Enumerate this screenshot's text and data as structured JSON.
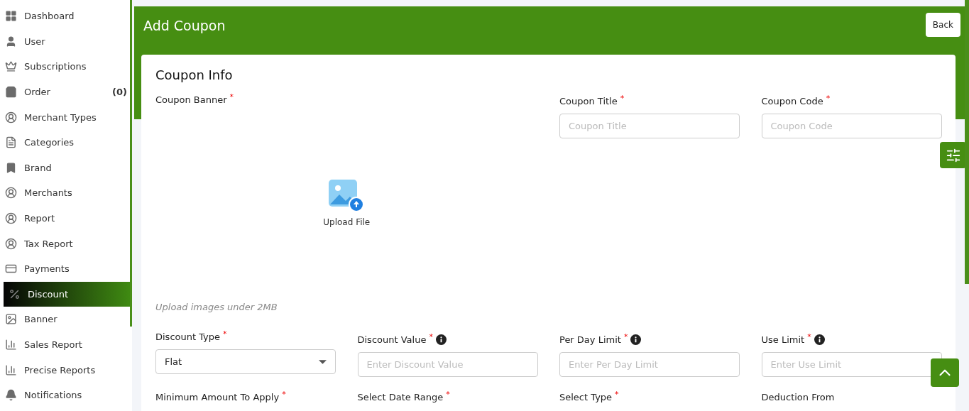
{
  "sidebar": {
    "items": [
      {
        "label": "Dashboard",
        "selected": false
      },
      {
        "label": "User",
        "selected": false
      },
      {
        "label": "Subscriptions",
        "selected": false
      },
      {
        "label": "Order",
        "count": "(0)",
        "selected": false
      },
      {
        "label": "Merchant Types",
        "selected": false
      },
      {
        "label": "Categories",
        "selected": false
      },
      {
        "label": "Brand",
        "selected": false
      },
      {
        "label": "Merchants",
        "selected": false
      },
      {
        "label": "Report",
        "selected": false
      },
      {
        "label": "Tax Report",
        "selected": false
      },
      {
        "label": "Payments",
        "selected": false
      },
      {
        "label": "Discount",
        "selected": true
      },
      {
        "label": "Banner",
        "selected": false
      },
      {
        "label": "Sales Report",
        "selected": false
      },
      {
        "label": "Precise Reports",
        "selected": false
      },
      {
        "label": "Notifications",
        "selected": false
      }
    ]
  },
  "header": {
    "title": "Add Coupon",
    "back_button": "Back"
  },
  "card": {
    "title": "Coupon Info",
    "banner": {
      "label": "Coupon Banner",
      "required_mark": "*",
      "upload_label": "Upload File",
      "hint": "Upload images under 2MB"
    },
    "top_fields": [
      {
        "label": "Coupon Title",
        "required_mark": "*",
        "placeholder": "Coupon Title"
      },
      {
        "label": "Coupon Code",
        "required_mark": "*",
        "placeholder": "Coupon Code"
      }
    ],
    "fields": [
      {
        "kind": "select",
        "label": "Discount Type",
        "required_mark": "*",
        "value": "Flat",
        "info": false
      },
      {
        "kind": "input",
        "label": "Discount Value",
        "required_mark": "*",
        "placeholder": "Enter Discount Value",
        "info": true
      },
      {
        "kind": "input",
        "label": "Per Day Limit",
        "required_mark": "*",
        "placeholder": "Enter Per Day Limit",
        "info": true
      },
      {
        "kind": "input",
        "label": "Use Limit",
        "required_mark": "*",
        "placeholder": "Enter Use Limit",
        "info": true
      },
      {
        "kind": "label",
        "label": "Minimum Amount To Apply",
        "required_mark": "*"
      },
      {
        "kind": "label",
        "label": "Select Date Range",
        "required_mark": "*"
      },
      {
        "kind": "label",
        "label": "Select Type",
        "required_mark": "*"
      },
      {
        "kind": "label",
        "label": "Deduction From"
      }
    ]
  }
}
